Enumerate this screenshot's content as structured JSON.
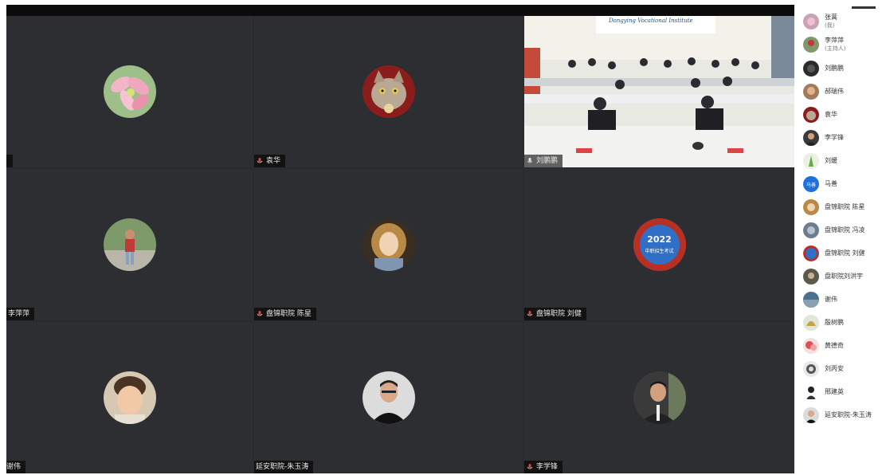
{
  "tiles": [
    {
      "name": "张蒿",
      "mic": false
    },
    {
      "name": "袁华",
      "mic": true
    },
    {
      "name": "刘鹏鹏",
      "mic": true,
      "video": true,
      "banner": "Dongying Vocational Institute"
    },
    {
      "name": "李萍萍",
      "mic": false
    },
    {
      "name": "盘锦职院 陈星",
      "mic": true
    },
    {
      "name": "盘锦职院 刘健",
      "mic": true,
      "logo_year": "2022",
      "logo_sub": "中职招生考试"
    },
    {
      "name": "谢伟",
      "mic": false
    },
    {
      "name": "延安职院-朱玉涛",
      "mic": false
    },
    {
      "name": "李学锋",
      "mic": true
    }
  ],
  "participants": [
    {
      "name": "张蒿",
      "role": "(我)"
    },
    {
      "name": "李萍萍",
      "role": "(主持人)"
    },
    {
      "name": "刘鹏鹏"
    },
    {
      "name": "郝瑞伟"
    },
    {
      "name": "袁华"
    },
    {
      "name": "李学锋"
    },
    {
      "name": "刘媛"
    },
    {
      "name": "马善",
      "badge": "马善"
    },
    {
      "name": "盘锦职院 陈星"
    },
    {
      "name": "盘锦职院 冯凌"
    },
    {
      "name": "盘锦职院 刘健"
    },
    {
      "name": "盘职院刘洪宇"
    },
    {
      "name": "谢伟"
    },
    {
      "name": "殷树鹏"
    },
    {
      "name": "黄德奇"
    },
    {
      "name": "刘丙安"
    },
    {
      "name": "邢建英"
    },
    {
      "name": "延安职院-朱玉涛"
    }
  ],
  "colors": {
    "tile_bg": "#2d2e31",
    "badge_blue": "#1e6fe0"
  }
}
